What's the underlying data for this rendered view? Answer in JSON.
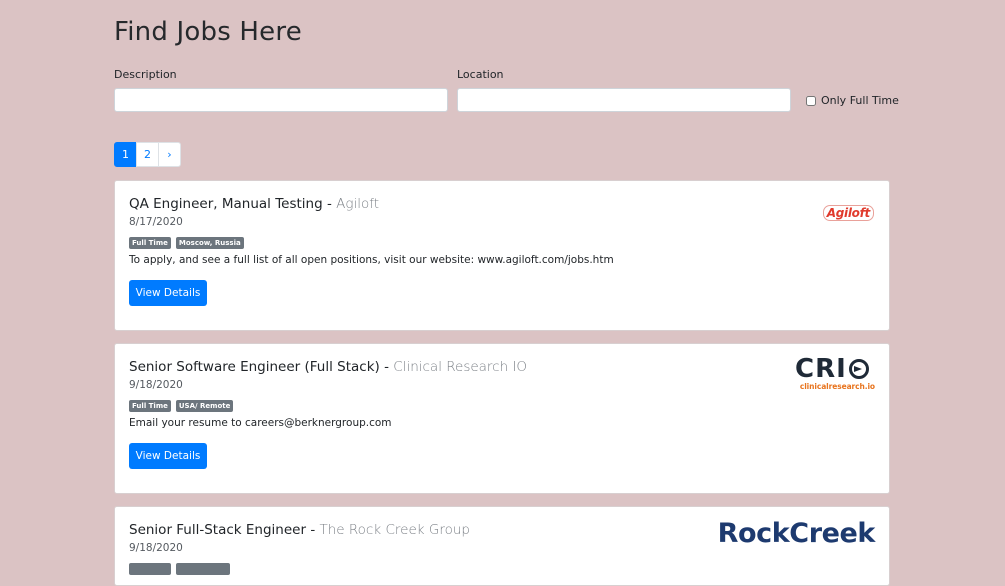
{
  "header": {
    "title": "Find Jobs Here"
  },
  "search": {
    "description_label": "Description",
    "description_value": "",
    "location_label": "Location",
    "location_value": "",
    "full_time_label": "Only Full Time",
    "full_time_checked": false
  },
  "pagination": {
    "pages": [
      "1",
      "2",
      "›"
    ],
    "active": "1"
  },
  "jobs": [
    {
      "title": "QA Engineer, Manual Testing",
      "separator": " - ",
      "company": "Agiloft",
      "date": "8/17/2020",
      "type": "Full Time",
      "location": "Moscow, Russia",
      "description": "To apply, and see a full list of all open positions, visit our website: www.agiloft.com/jobs.htm",
      "button": "View Details",
      "logo_text": "Agiloft"
    },
    {
      "title": "Senior Software Engineer (Full Stack)",
      "separator": " - ",
      "company": "Clinical Research IO",
      "date": "9/18/2020",
      "type": "Full Time",
      "location": "USA/ Remote",
      "description": "Email your resume to careers@berknergroup.com",
      "button": "View Details",
      "logo_text": "CRI",
      "logo_sub": "clinicalresearch.io"
    },
    {
      "title": "Senior Full-Stack Engineer",
      "separator": " - ",
      "company": "The Rock Creek Group",
      "date": "9/18/2020",
      "logo_text": "RockCreek"
    }
  ],
  "colors": {
    "background": "#dbc3c4",
    "primary": "#007bff",
    "badge": "#6c757d"
  }
}
